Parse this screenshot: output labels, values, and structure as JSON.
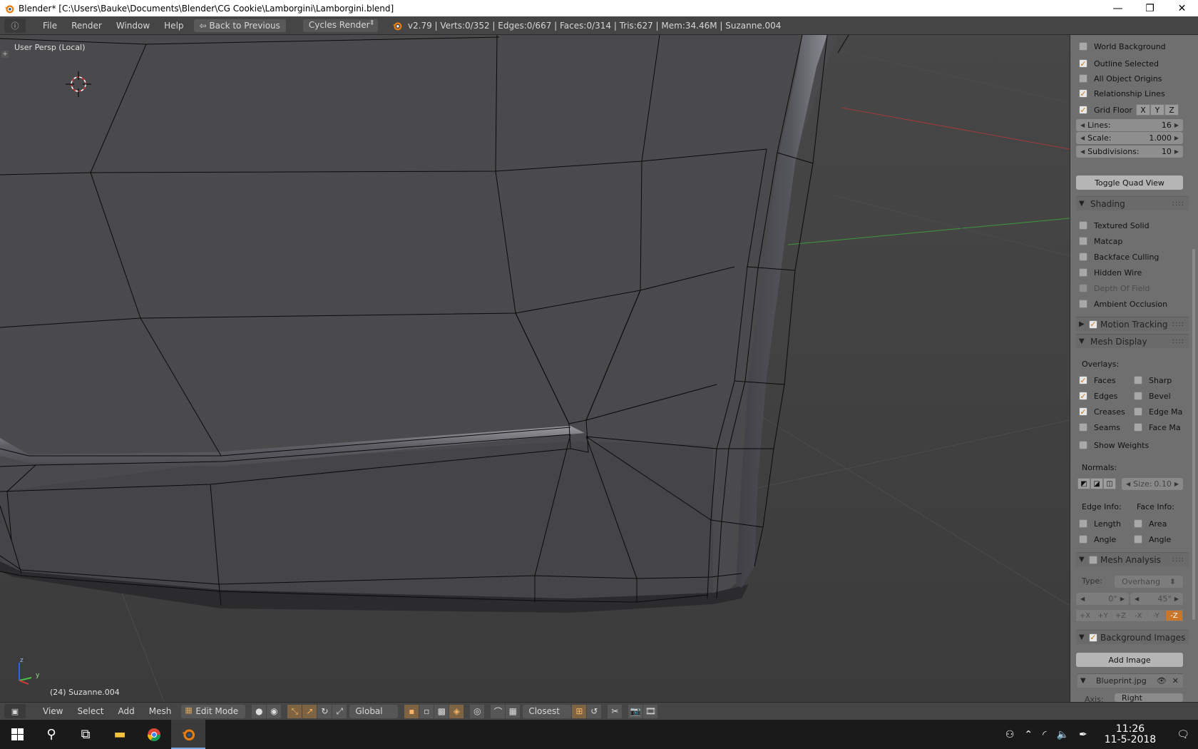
{
  "window": {
    "title": "Blender* [C:\\Users\\Bauke\\Documents\\Blender\\CG Cookie\\Lamborgini\\Lamborgini.blend]",
    "minimize": "—",
    "maximize": "❐",
    "close": "✕"
  },
  "infobar": {
    "editor_icon": "ⓘ",
    "menus": [
      "File",
      "Render",
      "Window",
      "Help"
    ],
    "back_label": "Back to Previous",
    "render_engine": "Cycles Render",
    "stats": "v2.79 | Verts:0/352 | Edges:0/667 | Faces:0/314 | Tris:627 | Mem:34.46M | Suzanne.004"
  },
  "viewport": {
    "view_label": "User Persp (Local)",
    "object_label": "(24) Suzanne.004",
    "axis_x": "y",
    "axis_z": "z"
  },
  "panel": {
    "display": {
      "world_background": "World Background",
      "outline_selected": "Outline Selected",
      "all_object_origins": "All Object Origins",
      "relationship_lines": "Relationship Lines",
      "grid_floor": "Grid Floor",
      "axes": [
        "X",
        "Y",
        "Z"
      ],
      "lines_label": "Lines:",
      "lines_value": "16",
      "scale_label": "Scale:",
      "scale_value": "1.000",
      "subdiv_label": "Subdivisions:",
      "subdiv_value": "10",
      "toggle_quad": "Toggle Quad View"
    },
    "shading": {
      "title": "Shading",
      "textured_solid": "Textured Solid",
      "matcap": "Matcap",
      "backface_culling": "Backface Culling",
      "hidden_wire": "Hidden Wire",
      "depth_of_field": "Depth Of Field",
      "ambient_occlusion": "Ambient Occlusion"
    },
    "motion_tracking": {
      "title": "Motion Tracking"
    },
    "mesh_display": {
      "title": "Mesh Display",
      "overlays": "Overlays:",
      "faces": "Faces",
      "sharp": "Sharp",
      "edges": "Edges",
      "bevel": "Bevel",
      "creases": "Creases",
      "edge_ma": "Edge Ma",
      "seams": "Seams",
      "face_ma": "Face Ma",
      "show_weights": "Show Weights",
      "normals": "Normals:",
      "size_label": "Size:",
      "size_value": "0.10",
      "edge_info": "Edge Info:",
      "face_info": "Face Info:",
      "length": "Length",
      "area": "Area",
      "angle": "Angle",
      "angle2": "Angle"
    },
    "mesh_analysis": {
      "title": "Mesh Analysis",
      "type_label": "Type:",
      "type_value": "Overhang",
      "min": "0°",
      "max": "45°",
      "axes": [
        "+X",
        "+Y",
        "+Z",
        "-X",
        "-Y",
        "-Z"
      ]
    },
    "background_images": {
      "title": "Background Images",
      "add_image": "Add Image",
      "image_name": "Blueprint.jpg",
      "axis_label": "Axis:",
      "axis_value": "Right"
    }
  },
  "bottombar": {
    "menus": [
      "View",
      "Select",
      "Add",
      "Mesh"
    ],
    "mode": "Edit Mode",
    "orientation": "Global",
    "snap": "Closest"
  },
  "taskbar": {
    "time": "11:26",
    "date": "11-5-2018"
  },
  "colors": {
    "accent_orange": "#c77b1e",
    "panel_bg": "#6f6f6f",
    "header_bg": "#454545"
  }
}
